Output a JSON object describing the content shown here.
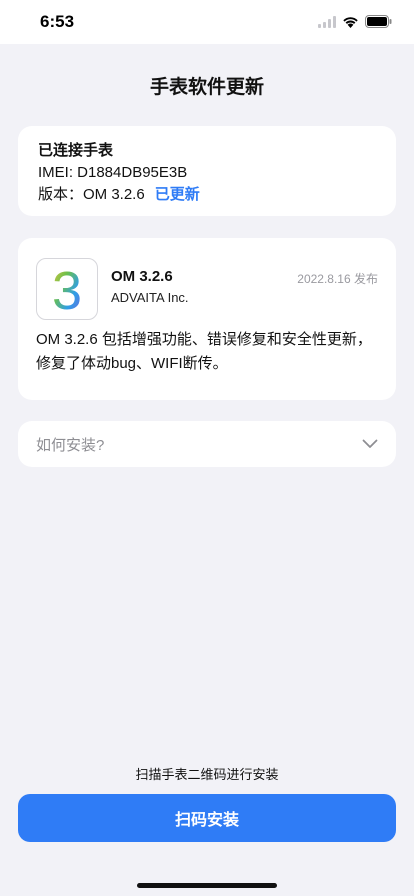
{
  "status_bar": {
    "time": "6:53",
    "icons": [
      "signal-icon",
      "wifi-icon",
      "battery-icon"
    ]
  },
  "header": {
    "title": "手表软件更新"
  },
  "device": {
    "heading": "已连接手表",
    "imei": "IMEI: D1884DB95E3B",
    "version_label": "版本：OM 3.2.6",
    "status": "已更新"
  },
  "update": {
    "icon_text": "3",
    "version": "OM 3.2.6",
    "company": "ADVAITA Inc.",
    "release_date": "2022.8.16 发布",
    "description": "OM 3.2.6 包括增强功能、错误修复和安全性更新，修复了体动bug、WIFI断传。"
  },
  "install": {
    "label": "如何安装?"
  },
  "footer": {
    "hint": "扫描手表二维码进行安装",
    "button_label": "扫码安装"
  },
  "colors": {
    "accent": "#2f7cf6",
    "background": "#f2f2f7",
    "card": "#ffffff"
  }
}
